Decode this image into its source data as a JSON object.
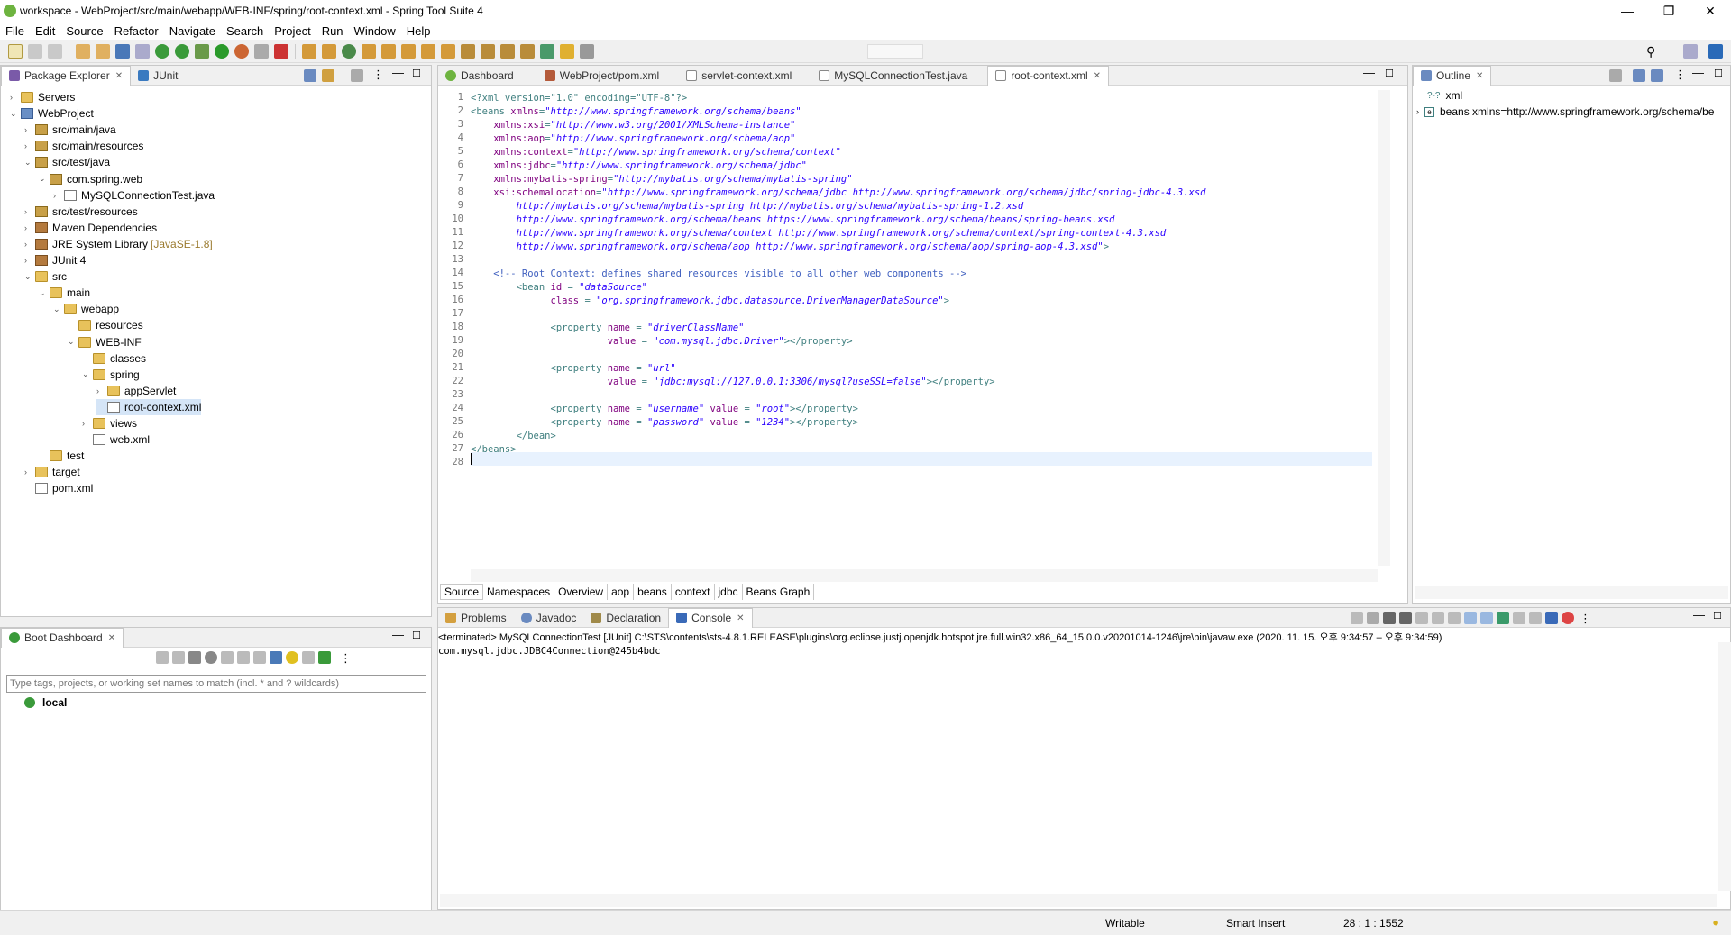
{
  "window": {
    "title": "workspace - WebProject/src/main/webapp/WEB-INF/spring/root-context.xml - Spring Tool Suite 4"
  },
  "menu": [
    "File",
    "Edit",
    "Source",
    "Refactor",
    "Navigate",
    "Search",
    "Project",
    "Run",
    "Window",
    "Help"
  ],
  "left_tabs": {
    "package_explorer": "Package Explorer",
    "junit": "JUnit"
  },
  "tree": [
    {
      "label": "Servers",
      "indent": 0,
      "arrow": "›",
      "icon": "folder"
    },
    {
      "label": "WebProject",
      "indent": 0,
      "arrow": "⌄",
      "icon": "proj"
    },
    {
      "label": "src/main/java",
      "indent": 1,
      "arrow": "›",
      "icon": "pkg"
    },
    {
      "label": "src/main/resources",
      "indent": 1,
      "arrow": "›",
      "icon": "pkg"
    },
    {
      "label": "src/test/java",
      "indent": 1,
      "arrow": "⌄",
      "icon": "pkg"
    },
    {
      "label": "com.spring.web",
      "indent": 2,
      "arrow": "⌄",
      "icon": "pkg"
    },
    {
      "label": "MySQLConnectionTest.java",
      "indent": 3,
      "arrow": "›",
      "icon": "file"
    },
    {
      "label": "src/test/resources",
      "indent": 1,
      "arrow": "›",
      "icon": "pkg"
    },
    {
      "label": "Maven Dependencies",
      "indent": 1,
      "arrow": "›",
      "icon": "lib"
    },
    {
      "label": "JRE System Library",
      "indent": 1,
      "arrow": "›",
      "icon": "lib",
      "decor": "[JavaSE-1.8]"
    },
    {
      "label": "JUnit 4",
      "indent": 1,
      "arrow": "›",
      "icon": "lib"
    },
    {
      "label": "src",
      "indent": 1,
      "arrow": "⌄",
      "icon": "folder"
    },
    {
      "label": "main",
      "indent": 2,
      "arrow": "⌄",
      "icon": "folder"
    },
    {
      "label": "webapp",
      "indent": 3,
      "arrow": "⌄",
      "icon": "folder"
    },
    {
      "label": "resources",
      "indent": 4,
      "arrow": "",
      "icon": "folder"
    },
    {
      "label": "WEB-INF",
      "indent": 4,
      "arrow": "⌄",
      "icon": "folder"
    },
    {
      "label": "classes",
      "indent": 5,
      "arrow": "",
      "icon": "folder"
    },
    {
      "label": "spring",
      "indent": 5,
      "arrow": "⌄",
      "icon": "folder"
    },
    {
      "label": "appServlet",
      "indent": 6,
      "arrow": "›",
      "icon": "folder"
    },
    {
      "label": "root-context.xml",
      "indent": 6,
      "arrow": "",
      "icon": "file",
      "selected": true
    },
    {
      "label": "views",
      "indent": 5,
      "arrow": "›",
      "icon": "folder"
    },
    {
      "label": "web.xml",
      "indent": 5,
      "arrow": "",
      "icon": "file"
    },
    {
      "label": "test",
      "indent": 2,
      "arrow": "",
      "icon": "folder"
    },
    {
      "label": "target",
      "indent": 1,
      "arrow": "›",
      "icon": "folder"
    },
    {
      "label": "pom.xml",
      "indent": 1,
      "arrow": "",
      "icon": "file"
    }
  ],
  "editor_tabs": [
    "Dashboard",
    "WebProject/pom.xml",
    "servlet-context.xml",
    "MySQLConnectionTest.java",
    "root-context.xml"
  ],
  "code": [
    [
      [
        "pi",
        "<?xml version=\"1.0\" encoding=\"UTF-8\"?>"
      ]
    ],
    [
      [
        "tag",
        "<beans "
      ],
      [
        "attr",
        "xmlns"
      ],
      [
        "tag",
        "="
      ],
      [
        "str",
        "\"http://www.springframework.org/schema/beans\""
      ]
    ],
    [
      [
        "tag",
        "    "
      ],
      [
        "attr",
        "xmlns:xsi"
      ],
      [
        "tag",
        "="
      ],
      [
        "str",
        "\"http://www.w3.org/2001/XMLSchema-instance\""
      ]
    ],
    [
      [
        "tag",
        "    "
      ],
      [
        "attr",
        "xmlns:aop"
      ],
      [
        "tag",
        "="
      ],
      [
        "str",
        "\"http://www.springframework.org/schema/aop\""
      ]
    ],
    [
      [
        "tag",
        "    "
      ],
      [
        "attr",
        "xmlns:context"
      ],
      [
        "tag",
        "="
      ],
      [
        "str",
        "\"http://www.springframework.org/schema/context\""
      ]
    ],
    [
      [
        "tag",
        "    "
      ],
      [
        "attr",
        "xmlns:jdbc"
      ],
      [
        "tag",
        "="
      ],
      [
        "str",
        "\"http://www.springframework.org/schema/jdbc\""
      ]
    ],
    [
      [
        "tag",
        "    "
      ],
      [
        "attr",
        "xmlns:mybatis-spring"
      ],
      [
        "tag",
        "="
      ],
      [
        "str",
        "\"http://mybatis.org/schema/mybatis-spring\""
      ]
    ],
    [
      [
        "tag",
        "    "
      ],
      [
        "attr",
        "xsi:schemaLocation"
      ],
      [
        "tag",
        "="
      ],
      [
        "str",
        "\"http://www.springframework.org/schema/jdbc http://www.springframework.org/schema/jdbc/spring-jdbc-4.3.xsd"
      ]
    ],
    [
      [
        "str",
        "        http://mybatis.org/schema/mybatis-spring http://mybatis.org/schema/mybatis-spring-1.2.xsd"
      ]
    ],
    [
      [
        "str",
        "        http://www.springframework.org/schema/beans https://www.springframework.org/schema/beans/spring-beans.xsd"
      ]
    ],
    [
      [
        "str",
        "        http://www.springframework.org/schema/context http://www.springframework.org/schema/context/spring-context-4.3.xsd"
      ]
    ],
    [
      [
        "str",
        "        http://www.springframework.org/schema/aop http://www.springframework.org/schema/aop/spring-aop-4.3.xsd\""
      ],
      [
        "tag",
        ">"
      ]
    ],
    [
      [
        "tag",
        ""
      ]
    ],
    [
      [
        "com",
        "    <!-- Root Context: defines shared resources visible to all other web components -->"
      ]
    ],
    [
      [
        "tag",
        "        <bean "
      ],
      [
        "attr",
        "id"
      ],
      [
        "tag",
        " = "
      ],
      [
        "str",
        "\"dataSource\""
      ]
    ],
    [
      [
        "tag",
        "              "
      ],
      [
        "attr",
        "class"
      ],
      [
        "tag",
        " = "
      ],
      [
        "str",
        "\"org.springframework.jdbc.datasource.DriverManagerDataSource\""
      ],
      [
        "tag",
        ">"
      ]
    ],
    [
      [
        "tag",
        ""
      ]
    ],
    [
      [
        "tag",
        "              <property "
      ],
      [
        "attr",
        "name"
      ],
      [
        "tag",
        " = "
      ],
      [
        "str",
        "\"driverClassName\""
      ]
    ],
    [
      [
        "tag",
        "                        "
      ],
      [
        "attr",
        "value"
      ],
      [
        "tag",
        " = "
      ],
      [
        "str",
        "\"com.mysql.jdbc.Driver\""
      ],
      [
        "tag",
        "></property>"
      ]
    ],
    [
      [
        "tag",
        ""
      ]
    ],
    [
      [
        "tag",
        "              <property "
      ],
      [
        "attr",
        "name"
      ],
      [
        "tag",
        " = "
      ],
      [
        "str",
        "\"url\""
      ]
    ],
    [
      [
        "tag",
        "                        "
      ],
      [
        "attr",
        "value"
      ],
      [
        "tag",
        " = "
      ],
      [
        "str",
        "\"jdbc:mysql://127.0.0.1:3306/mysql?useSSL=false\""
      ],
      [
        "tag",
        "></property>"
      ]
    ],
    [
      [
        "tag",
        ""
      ]
    ],
    [
      [
        "tag",
        "              <property "
      ],
      [
        "attr",
        "name"
      ],
      [
        "tag",
        " = "
      ],
      [
        "str",
        "\"username\""
      ],
      [
        "tag",
        " "
      ],
      [
        "attr",
        "value"
      ],
      [
        "tag",
        " = "
      ],
      [
        "str",
        "\"root\""
      ],
      [
        "tag",
        "></property>"
      ]
    ],
    [
      [
        "tag",
        "              <property "
      ],
      [
        "attr",
        "name"
      ],
      [
        "tag",
        " = "
      ],
      [
        "str",
        "\"password\""
      ],
      [
        "tag",
        " "
      ],
      [
        "attr",
        "value"
      ],
      [
        "tag",
        " = "
      ],
      [
        "str",
        "\"1234\""
      ],
      [
        "tag",
        "></property>"
      ]
    ],
    [
      [
        "tag",
        "        </bean>"
      ]
    ],
    [
      [
        "tag",
        "</beans>"
      ]
    ],
    [
      [
        "tag",
        ""
      ]
    ]
  ],
  "editor_bottom_tabs": [
    "Source",
    "Namespaces",
    "Overview",
    "aop",
    "beans",
    "context",
    "jdbc",
    "Beans Graph"
  ],
  "outline": {
    "tab": "Outline",
    "items": [
      "xml",
      "beans xmlns=http://www.springframework.org/schema/be"
    ]
  },
  "boot": {
    "tab": "Boot Dashboard",
    "filter_placeholder": "Type tags, projects, or working set names to match (incl. * and ? wildcards)",
    "item": "local"
  },
  "console": {
    "tabs": [
      "Problems",
      "Javadoc",
      "Declaration",
      "Console"
    ],
    "header": "<terminated> MySQLConnectionTest [JUnit] C:\\STS\\contents\\sts-4.8.1.RELEASE\\plugins\\org.eclipse.justj.openjdk.hotspot.jre.full.win32.x86_64_15.0.0.v20201014-1246\\jre\\bin\\javaw.exe  (2020. 11. 15. 오후 9:34:57 – 오후 9:34:59)",
    "output": "com.mysql.jdbc.JDBC4Connection@245b4bdc"
  },
  "status": {
    "writable": "Writable",
    "insert": "Smart Insert",
    "position": "28 : 1 : 1552"
  }
}
